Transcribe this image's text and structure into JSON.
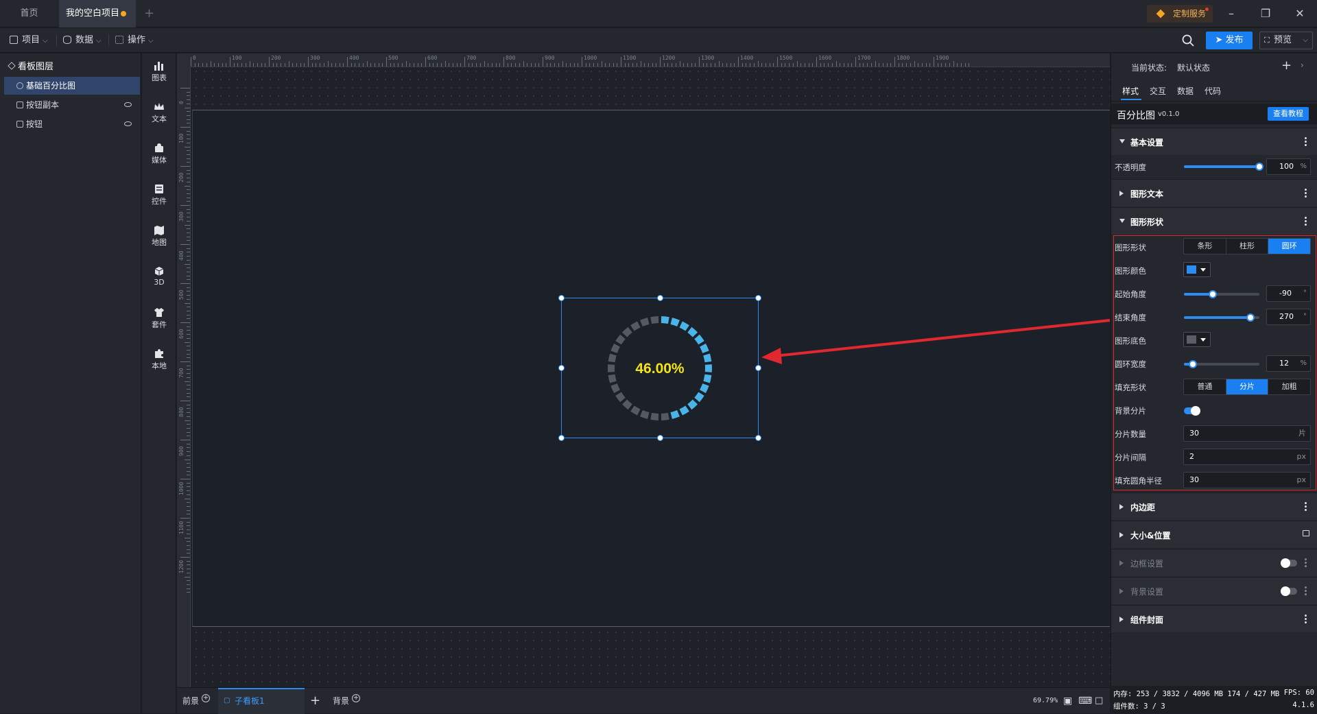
{
  "tabs": {
    "home": "首页",
    "project": "我的空白项目"
  },
  "custom_service": "定制服务",
  "menu": {
    "project": "项目",
    "data": "数据",
    "operation": "操作"
  },
  "toolbar": {
    "publish": "发布",
    "preview": "预览"
  },
  "layers": {
    "title": "看板图层",
    "items": [
      {
        "label": "基础百分比图",
        "selected": true,
        "hidden": false
      },
      {
        "label": "按钮副本",
        "selected": false,
        "hidden": true
      },
      {
        "label": "按钮",
        "selected": false,
        "hidden": true
      }
    ]
  },
  "components": {
    "chart": "图表",
    "text": "文本",
    "media": "媒体",
    "control": "控件",
    "map": "地图",
    "three_d": "3D",
    "kit": "套件",
    "local": "本地"
  },
  "ruler": {
    "top": [
      "0",
      "100",
      "200",
      "300",
      "400",
      "500",
      "600",
      "700",
      "800",
      "900",
      "1000",
      "1100",
      "1200",
      "1300",
      "1400",
      "1500",
      "1600",
      "1700",
      "1800",
      "1900"
    ],
    "left": [
      "0",
      "100",
      "200",
      "300",
      "400",
      "500",
      "600",
      "700",
      "800",
      "900",
      "1000",
      "1100",
      "1200"
    ]
  },
  "widget": {
    "percent_text": "46.00%",
    "percent": 46,
    "segments": 30,
    "fill_color": "#4ab3e8",
    "bg_color": "#555a62",
    "text_color": "#f5e31a"
  },
  "bottom": {
    "front": "前景",
    "subboard": "子看板1",
    "background": "背景",
    "zoom": "69.79%"
  },
  "panel": {
    "state_label": "当前状态:",
    "state_value": "默认状态",
    "tabs": [
      "样式",
      "交互",
      "数据",
      "代码"
    ],
    "active_tab": "样式",
    "component_name": "百分比图",
    "version": "v0.1.0",
    "tutorial_button": "查看教程",
    "sections": {
      "basic": "基本设置",
      "shape_text": "图形文本",
      "shape": "图形形状",
      "padding": "内边距",
      "size_pos": "大小&位置",
      "border": "边框设置",
      "background": "背景设置",
      "cover": "组件封面"
    },
    "opacity": {
      "label": "不透明度",
      "value": "100",
      "unit": "%",
      "level": 1.0
    },
    "shape_type": {
      "label": "图形形状",
      "options": [
        "条形",
        "柱形",
        "圆环"
      ],
      "selected": "圆环"
    },
    "shape_color": {
      "label": "图形颜色",
      "color": "#2d8cf0"
    },
    "start_angle": {
      "label": "起始角度",
      "value": "-90",
      "unit": "°",
      "level": 0.38
    },
    "end_angle": {
      "label": "结束角度",
      "value": "270",
      "unit": "°",
      "level": 0.88
    },
    "base_color": {
      "label": "图形底色",
      "color": "#5a5e66"
    },
    "ring_width": {
      "label": "圆环宽度",
      "value": "12",
      "unit": "%",
      "level": 0.12
    },
    "fill_shape": {
      "label": "填充形状",
      "options": [
        "普通",
        "分片",
        "加粗"
      ],
      "selected": "分片"
    },
    "bg_slices": {
      "label": "背景分片",
      "on": true
    },
    "slice_count": {
      "label": "分片数量",
      "value": "30",
      "unit": "片"
    },
    "slice_gap": {
      "label": "分片间隔",
      "value": "2",
      "unit": "px"
    },
    "fill_radius": {
      "label": "填充圆角半径",
      "value": "30",
      "unit": "px"
    }
  },
  "status": {
    "memory": "内存: 253 / 3832 / 4096 MB 174 / 427 MB",
    "fps": "FPS: 60",
    "count": "组件数: 3 / 3",
    "version": "4.1.6"
  }
}
